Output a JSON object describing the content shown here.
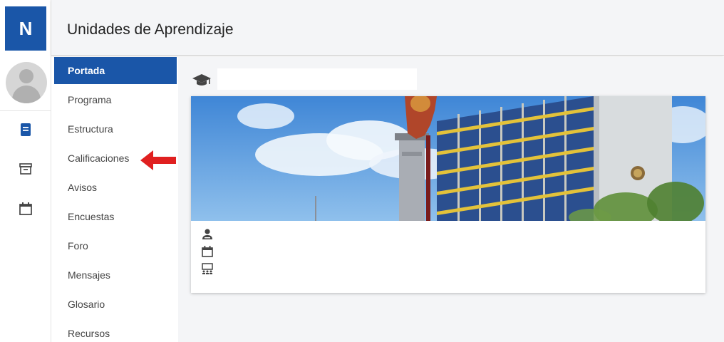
{
  "rail": {
    "logo_text": "N",
    "icons": [
      "book-icon",
      "archive-icon",
      "calendar-icon"
    ],
    "accent": "#1a56a8"
  },
  "header": {
    "title": "Unidades de Aprendizaje"
  },
  "menu": {
    "items": [
      {
        "label": "Portada",
        "active": true
      },
      {
        "label": "Programa",
        "active": false
      },
      {
        "label": "Estructura",
        "active": false
      },
      {
        "label": "Calificaciones",
        "active": false
      },
      {
        "label": "Avisos",
        "active": false
      },
      {
        "label": "Encuestas",
        "active": false
      },
      {
        "label": "Foro",
        "active": false
      },
      {
        "label": "Mensajes",
        "active": false
      },
      {
        "label": "Glosario",
        "active": false
      },
      {
        "label": "Recursos",
        "active": false
      }
    ],
    "highlight_arrow_color": "#e02020"
  },
  "main": {
    "course_icon": "graduation-cap-icon",
    "banner_image": "campus-building-photo",
    "info_icons": [
      "teacher-icon",
      "calendar-icon",
      "classroom-icon"
    ]
  },
  "colors": {
    "primary": "#1a56a8",
    "background": "#f4f5f7",
    "text": "#222222"
  }
}
